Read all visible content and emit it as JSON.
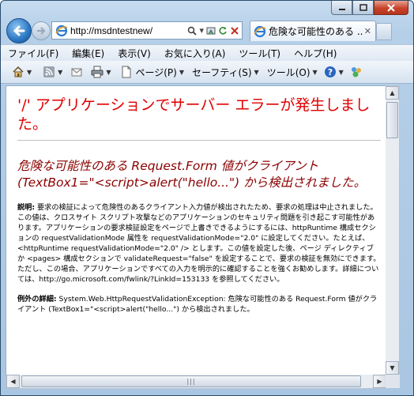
{
  "browser": {
    "address_url": "http://msdntestnew/",
    "tab_title": "危険な可能性のある ...",
    "menu": [
      "ファイル(F)",
      "編集(E)",
      "表示(V)",
      "お気に入り(A)",
      "ツール(T)",
      "ヘルプ(H)"
    ],
    "commands": {
      "page": "ページ(P)",
      "safety": "セーフティ(S)",
      "tools": "ツール(O)"
    }
  },
  "page": {
    "title": "'/' アプリケーションでサーバー エラーが発生しました。",
    "subtitle": "危険な可能性のある Request.Form 値がクライアント (TextBox1=\"<script>alert(\"hello...\") から検出されました。",
    "description_label": "説明:",
    "description_text": " 要求の検証によって危険性のあるクライアント入力値が検出されたため、要求の処理は中止されました。この値は、クロスサイト スクリプト攻撃などのアプリケーションのセキュリティ問題を引き起こす可能性があります。アプリケーションの要求検証設定をページで上書きできるようにするには、httpRuntime 構成セクションの requestValidationMode 属性を requestValidationMode=\"2.0\" に設定してください。たとえば、<httpRuntime requestValidationMode=\"2.0\" /> とします。この値を設定した後、ページ ディレクティブか <pages> 構成セクションで validateRequest=\"false\" を設定することで、要求の検証を無効にできます。ただし、この場合、アプリケーションですべての入力を明示的に確認することを強くお勧めします。詳細については、http://go.microsoft.com/fwlink/?LinkId=153133 を参照してください。",
    "exception_label": "例外の詳細:",
    "exception_text": " System.Web.HttpRequestValidationException: 危険な可能性のある Request.Form 値がクライアント (TextBox1=\"<script>alert(\"hello...\") から検出されました。"
  }
}
